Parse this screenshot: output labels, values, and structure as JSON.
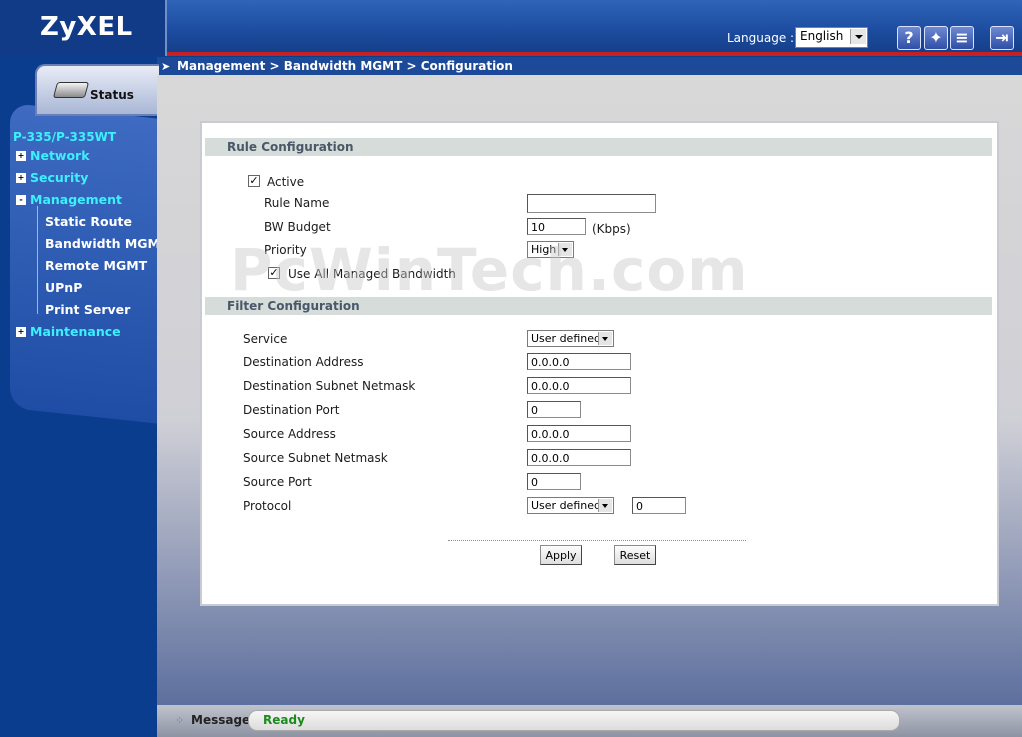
{
  "header": {
    "logo": "ZyXEL",
    "language_label": "Language :",
    "language_value": "English",
    "icons": [
      "help-icon",
      "wizard-icon",
      "notes-icon",
      "logout-icon"
    ]
  },
  "breadcrumb": "Management > Bandwidth MGMT > Configuration",
  "sidebar": {
    "status_tab": "Status",
    "model": "P-335/P-335WT",
    "items": [
      {
        "label": "Network",
        "expander": "+"
      },
      {
        "label": "Security",
        "expander": "+"
      },
      {
        "label": "Management",
        "expander": "-"
      },
      {
        "label": "Maintenance",
        "expander": "+"
      }
    ],
    "subitems": [
      "Static Route",
      "Bandwidth MGMT",
      "Remote MGMT",
      "UPnP",
      "Print Server"
    ]
  },
  "rule_config": {
    "title": "Rule Configuration",
    "active_label": "Active",
    "active_checked": "✓",
    "rule_name_label": "Rule Name",
    "rule_name_value": "",
    "bw_budget_label": "BW Budget",
    "bw_budget_value": "10",
    "bw_unit": "(Kbps)",
    "priority_label": "Priority",
    "priority_value": "High",
    "use_all_label": "Use All Managed Bandwidth",
    "use_all_checked": "✓"
  },
  "filter_config": {
    "title": "Filter Configuration",
    "service_label": "Service",
    "service_value": "User defined",
    "dest_addr_label": "Destination Address",
    "dest_addr_value": "0.0.0.0",
    "dest_mask_label": "Destination Subnet Netmask",
    "dest_mask_value": "0.0.0.0",
    "dest_port_label": "Destination Port",
    "dest_port_value": "0",
    "src_addr_label": "Source Address",
    "src_addr_value": "0.0.0.0",
    "src_mask_label": "Source Subnet Netmask",
    "src_mask_value": "0.0.0.0",
    "src_port_label": "Source Port",
    "src_port_value": "0",
    "protocol_label": "Protocol",
    "protocol_value": "User defined",
    "protocol_number": "0"
  },
  "buttons": {
    "apply": "Apply",
    "reset": "Reset"
  },
  "footer": {
    "message_label": "Message",
    "message_text": "Ready"
  },
  "watermark": "PcWinTech.com"
}
